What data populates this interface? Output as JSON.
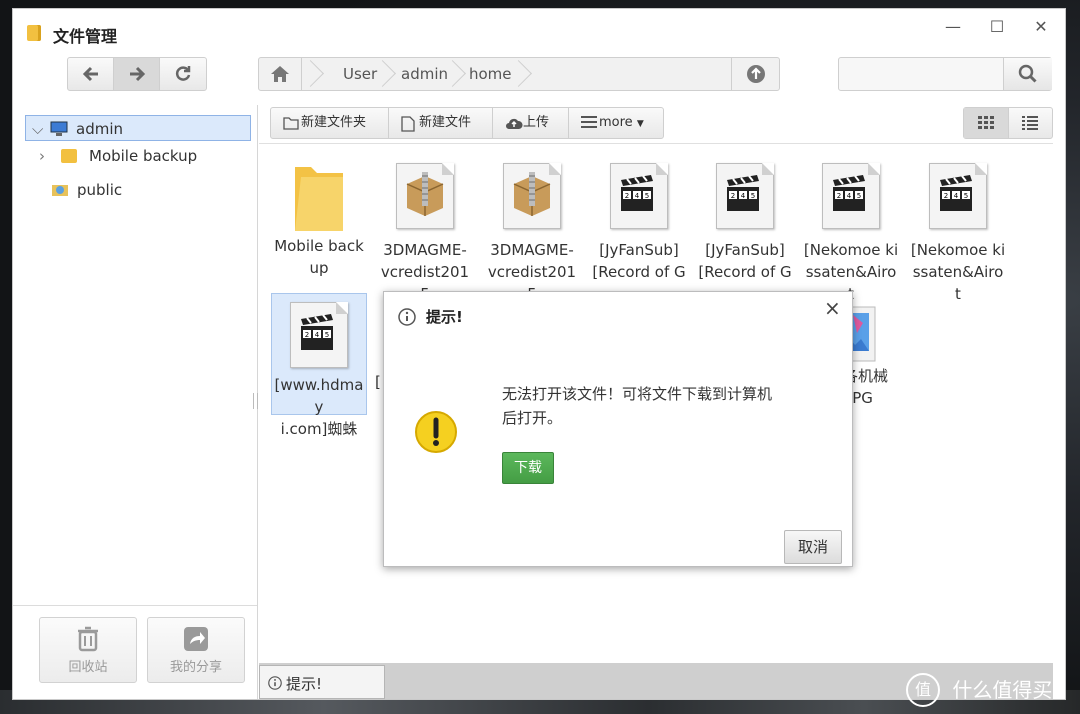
{
  "window": {
    "title": "文件管理",
    "controls": {
      "minimize": "—",
      "maximize": "☐",
      "close": "✕"
    }
  },
  "nav": {
    "breadcrumb": [
      "User",
      "admin",
      "home"
    ]
  },
  "search": {
    "placeholder": ""
  },
  "sidebar": {
    "tree": [
      {
        "label": "admin",
        "selected": true,
        "expanded": true
      },
      {
        "label": "Mobile backup",
        "selected": false
      },
      {
        "label": "public",
        "selected": false
      }
    ],
    "bottom": {
      "recycle": "回收站",
      "share": "我的分享"
    }
  },
  "toolbar": {
    "new_folder": "新建文件夹",
    "new_file": "新建文件",
    "upload": "上传",
    "more": "more"
  },
  "files": [
    {
      "line1": "Mobile back",
      "line2": "up",
      "type": "folder"
    },
    {
      "line1": "3DMAGME-",
      "line2": "vcredist2015",
      "type": "archive"
    },
    {
      "line1": "3DMAGME-",
      "line2": "vcredist2015",
      "type": "archive"
    },
    {
      "line1": "[JyFanSub]",
      "line2": "[Record of G",
      "type": "video"
    },
    {
      "line1": "[JyFanSub]",
      "line2": "[Record of G",
      "type": "video"
    },
    {
      "line1": "[Nekomoe ki",
      "line2": "ssaten&Airot",
      "type": "video"
    },
    {
      "line1": "[Nekomoe ki",
      "line2": "ssaten&Airot",
      "type": "video"
    },
    {
      "line1": "[www.hdmay",
      "line2": "i.com]蜘蛛",
      "type": "video",
      "selected": true
    },
    {
      "line1": "[",
      "line2": "",
      "type": "partial"
    },
    {
      "line1": "各机械",
      "line2": ".JPG",
      "type": "image"
    }
  ],
  "clap_digits": [
    "2",
    "4",
    "5"
  ],
  "dialog": {
    "title": "提示!",
    "message_line1": "无法打开该文件！可将文件下载到计算机",
    "message_line2": "后打开。",
    "download": "下载",
    "cancel": "取消",
    "close": "×"
  },
  "statusbar": {
    "tip": "提示!"
  },
  "watermark": {
    "text": "什么值得买",
    "badge": "值"
  },
  "colors": {
    "accent_green": "#4cae4c",
    "folder_yellow": "#f3c245",
    "selection_blue": "#dbe9fb"
  }
}
